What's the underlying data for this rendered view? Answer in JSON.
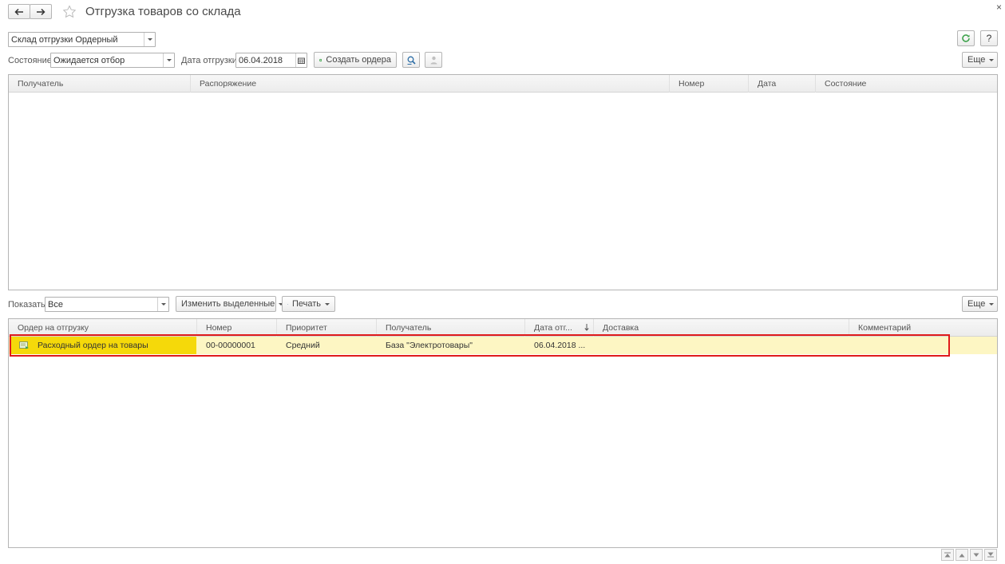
{
  "window": {
    "title": "Отгрузка товаров со склада",
    "close": "×"
  },
  "top": {
    "warehouse_value": "Склад отгрузки Ордерный",
    "help": "?"
  },
  "filters": {
    "state_label": "Состояние:",
    "state_value": "Ожидается отбор",
    "date_label": "Дата отгрузки:",
    "date_value": "06.04.2018",
    "create_orders": "Создать ордера",
    "more": "Еще"
  },
  "upper_table": {
    "columns": [
      "Получатель",
      "Распоряжение",
      "Номер",
      "Дата",
      "Состояние"
    ]
  },
  "lower_toolbar": {
    "show_label": "Показать:",
    "show_value": "Все",
    "change_selected": "Изменить выделенные",
    "print": "Печать",
    "more": "Еще"
  },
  "lower_table": {
    "columns": [
      "Ордер на отгрузку",
      "Номер",
      "Приоритет",
      "Получатель",
      "Дата отг...",
      "Доставка",
      "Комментарий"
    ],
    "rows": [
      {
        "order": "Расходный ордер на товары",
        "number": "00-00000001",
        "priority": "Средний",
        "recipient": "База \"Электротовары\"",
        "date": "06.04.2018 ...",
        "delivery": "",
        "comment": ""
      }
    ]
  },
  "colors": {
    "selected_row": "#fdf6c3",
    "selected_cell": "#f5d90a",
    "highlight_border": "#e01b1b",
    "refresh_icon": "#3fa34d",
    "create_icon": "#3fa34d"
  }
}
